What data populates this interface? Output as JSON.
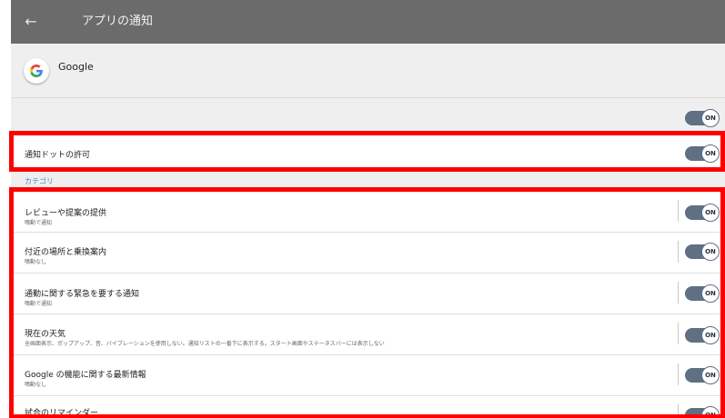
{
  "header": {
    "back_icon": "back-arrow-icon",
    "title": "アプリの通知"
  },
  "app": {
    "name": "Google",
    "icon": "google-logo-icon"
  },
  "master": {
    "toggle_state": "ON"
  },
  "dot_setting": {
    "label": "通知ドットの許可",
    "toggle_state": "ON"
  },
  "category": {
    "label": "カテゴリ",
    "items": [
      {
        "title": "レビューや提案の提供",
        "subtitle": "鳴動で通知",
        "toggle_state": "ON"
      },
      {
        "title": "付近の場所と乗換案内",
        "subtitle": "鳴動なし",
        "toggle_state": "ON"
      },
      {
        "title": "通勤に関する緊急を要する通知",
        "subtitle": "鳴動で通知",
        "toggle_state": "ON"
      },
      {
        "title": "現在の天気",
        "subtitle": "全画面表示、ポップアップ、音、バイブレーションを使用しない。通知リストの一番下に表示する。スタート画面やステータスバーには表示しない",
        "toggle_state": "ON"
      },
      {
        "title": "Google の機能に関する最新情報",
        "subtitle": "鳴動なし",
        "toggle_state": "ON"
      },
      {
        "title": "試合のリマインダー",
        "subtitle": "",
        "toggle_state": "ON"
      }
    ]
  },
  "colors": {
    "highlight": "#ff0000",
    "toolbar": "#6b6b6b",
    "toggle": "#5f6f84",
    "accent": "#4a86c5"
  }
}
